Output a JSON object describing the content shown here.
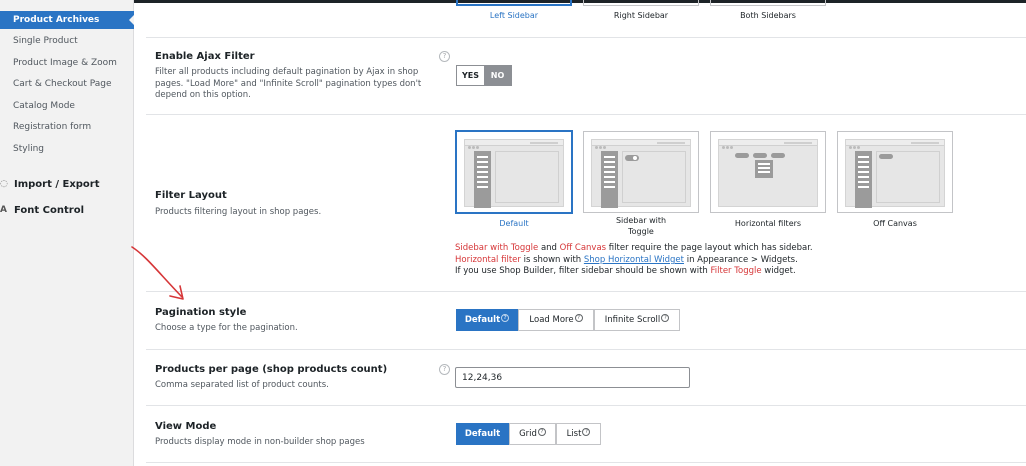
{
  "sidebar": {
    "active": "Product Archives",
    "items": [
      "Single Product",
      "Product Image & Zoom",
      "Cart & Checkout Page",
      "Catalog Mode",
      "Registration form",
      "Styling"
    ],
    "main": [
      {
        "label": "Import / Export",
        "icon": "import-export-icon"
      },
      {
        "label": "Font Control",
        "icon": "font-control-icon"
      }
    ]
  },
  "page_layout": {
    "options": [
      "Left Sidebar",
      "Right Sidebar",
      "Both Sidebars"
    ],
    "selected": "Left Sidebar"
  },
  "ajax_filter": {
    "label": "Enable Ajax Filter",
    "desc_lines": [
      "Filter all products including default pagination by Ajax in shop",
      "pages. \"Load More\" and \"Infinite Scroll\" pagination types don't",
      "depend on this option."
    ],
    "yes": "YES",
    "no": "NO",
    "value": "NO"
  },
  "filter_layout": {
    "label": "Filter Layout",
    "desc": "Products filtering layout in shop pages.",
    "options": [
      "Default",
      "Sidebar with Toggle",
      "Horizontal filters",
      "Off Canvas"
    ],
    "option2_lines": [
      "Sidebar with",
      "Toggle"
    ],
    "selected": "Default",
    "notes": {
      "line1": {
        "red1": "Sidebar with Toggle",
        "t1": " and ",
        "red2": "Off Canvas",
        "t2": " filter require the page layout which has sidebar."
      },
      "line2": {
        "red1": "Horizontal filter",
        "t1": " is shown with ",
        "link": "Shop Horizontal Widget",
        "t2": " in Appearance > Widgets."
      },
      "line3": {
        "t1": "If you use Shop Builder, filter sidebar should be shown with ",
        "red1": "Filter Toggle",
        "t2": " widget."
      }
    }
  },
  "pagination": {
    "label": "Pagination style",
    "desc": "Choose a type for the pagination.",
    "options": [
      "Default",
      "Load More",
      "Infinite Scroll"
    ],
    "selected": "Default"
  },
  "per_page": {
    "label": "Products per page (shop products count)",
    "desc": "Comma separated list of product counts.",
    "value": "12,24,36"
  },
  "view_mode": {
    "label": "View Mode",
    "desc": "Products display mode in non-builder shop pages",
    "options": [
      "Default",
      "Grid",
      "List"
    ],
    "selected": "Default"
  },
  "help_glyph": "?",
  "colors": {
    "accent": "#2a74c4",
    "warning": "#d63638",
    "annotation_arrow": "#d63638"
  }
}
